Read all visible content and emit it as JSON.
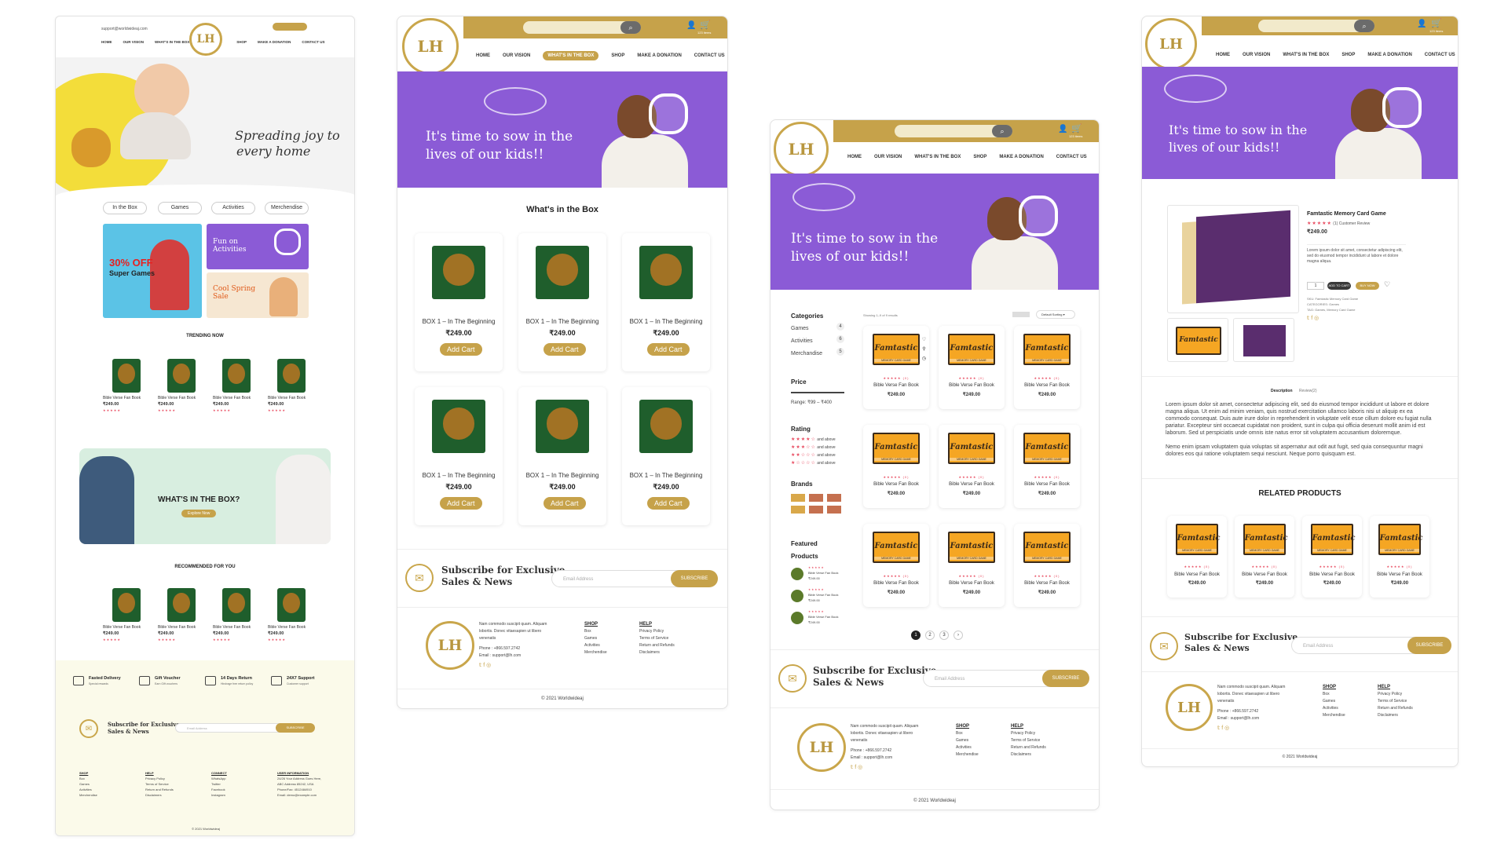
{
  "brand": {
    "logo_text": "LH",
    "gold": "#c6a24a",
    "purple": "#8b5bd6"
  },
  "nav": {
    "home": "HOME",
    "vision": "OUR VISION",
    "box": "WHAT'S IN THE BOX",
    "shop": "SHOP",
    "donation": "MAKE A DONATION",
    "contact": "CONTACT US"
  },
  "cart": {
    "label": "123 items"
  },
  "hero": {
    "line1": "It's time to sow in the",
    "line2": "lives of our kids!!"
  },
  "home": {
    "email": "support@worldwideaj.com",
    "hero_text1": "Spreading joy to",
    "hero_text2": "every home",
    "pills": [
      "In the Box",
      "Games",
      "Activities",
      "Merchendise"
    ],
    "promo1": "30% OFF",
    "promo1b": "Super Games",
    "promo2": "Fun on Activities",
    "promo3": "Cool Spring Sale",
    "trending": "TRENDING NOW",
    "recommended": "RECOMMENDED FOR YOU",
    "box_banner": "WHAT'S IN THE BOX?",
    "explore": "Explore Now",
    "product": "Bible Verse Fan Book",
    "price": "₹249.00",
    "features": [
      {
        "t": "Fasted Delivery",
        "s": "Special rewards"
      },
      {
        "t": "Gift Voucher",
        "s": "Earn Gift vouchers"
      },
      {
        "t": "14 Days Return",
        "s": "Hindrage free return policy"
      },
      {
        "t": "24X7 Support",
        "s": "Customer support"
      }
    ],
    "footer_cols": [
      {
        "h": "SHOP",
        "items": [
          "Box",
          "Games",
          "Activities",
          "Merchendise"
        ]
      },
      {
        "h": "HELP",
        "items": [
          "Privacy Policy",
          "Terms of Service",
          "Return and Refunds",
          "Disclaimers"
        ]
      },
      {
        "h": "CONNECT",
        "items": [
          "WhatsApp",
          "Twitter",
          "Facebook",
          "Instagram"
        ]
      },
      {
        "h": "USER INFORMATION",
        "items": [
          "24/26 Your Address Goes Here,",
          "ABC Address 85242, USA",
          "Phone/Fax: 4512484910",
          "Email: demo@example.com"
        ]
      }
    ]
  },
  "box_page": {
    "title": "What's in the Box",
    "item": "BOX 1 – In The Beginning",
    "price": "₹249.00",
    "add": "Add Cart"
  },
  "subscribe": {
    "l1": "Subscribe for Exclusive",
    "l2": "Sales & News",
    "placeholder": "Email Address",
    "btn": "SUBSCRIBE"
  },
  "footer": {
    "about1": "Nam commodo suscipit quam. Aliquam",
    "about2": "lobortis. Donec vitaesapien ut libero",
    "about3": "venenatis",
    "phone": "Phone : +866.597.2742",
    "email": "Email : support@lh.com",
    "shop_h": "SHOP",
    "shop": [
      "Box",
      "Games",
      "Activities",
      "Merchendise"
    ],
    "help_h": "HELP",
    "help": [
      "Privacy Policy",
      "Terms of Service",
      "Return and Refunds",
      "Disclaimers"
    ],
    "copy": "© 2021 Worldwideaj"
  },
  "shop_page": {
    "showing": "Showing 1–9 of 9 results",
    "sort": "Default Sorting",
    "cat_h": "Categories",
    "cats": [
      {
        "n": "Games",
        "c": "4"
      },
      {
        "n": "Activities",
        "c": "6"
      },
      {
        "n": "Merchandise",
        "c": "5"
      }
    ],
    "price_h": "Price",
    "range": "Range: ₹99 – ₹400",
    "rating_h": "Rating",
    "and_above": "and above",
    "brands_h": "Brands",
    "featured_h": "Featured Products",
    "product": "Bible Verse Fan Book",
    "price": "₹249.00",
    "game_title": "Famtastic",
    "game_sub": "MEMORY CARD GAME",
    "pages": [
      "1",
      "2",
      "3",
      "›"
    ]
  },
  "detail_page": {
    "name": "Famtastic Memory Card Game",
    "reviews": "(1) Customer Review",
    "price": "₹249.00",
    "desc": "Lorem ipsum dolor sit amet, consectetur adipiscing elit, sed do eiusmod tempor incididunt ut labore et dolore magna aliqua.",
    "qty": "1",
    "add": "ADD TO CART",
    "buy": "BUY NOW",
    "sku": "SKU: Famtastic Memory Card Game",
    "cat": "CATEGORIES: Games",
    "tags": "TAG: Games, Memory Card Game",
    "tab1": "Description",
    "tab2": "Review(2)",
    "long1": "Lorem ipsum dolor sit amet, consectetur adipiscing elit, sed do eiusmod tempor incididunt ut labore et dolore magna aliqua. Ut enim ad minim veniam, quis nostrud exercitation ullamco laboris nisi ut aliquip ex ea commodo consequat. Duis aute irure dolor in reprehenderit in voluptate velit esse cillum dolore eu fugiat nulla pariatur. Excepteur sint occaecat cupidatat non proident, sunt in culpa qui officia deserunt mollit anim id est laborum. Sed ut perspiciatis unde omnis iste natus error sit voluptatem accusantium doloremque.",
    "long2": "Nemo enim ipsam voluptatem quia voluptas sit aspernatur aut odit aut fugit, sed quia consequuntur magni dolores eos qui ratione voluptatem sequi nesciunt. Neque porro quisquam est.",
    "related": "RELATED PRODUCTS",
    "product": "Bible Verse Fan Book",
    "price2": "₹249.00"
  }
}
